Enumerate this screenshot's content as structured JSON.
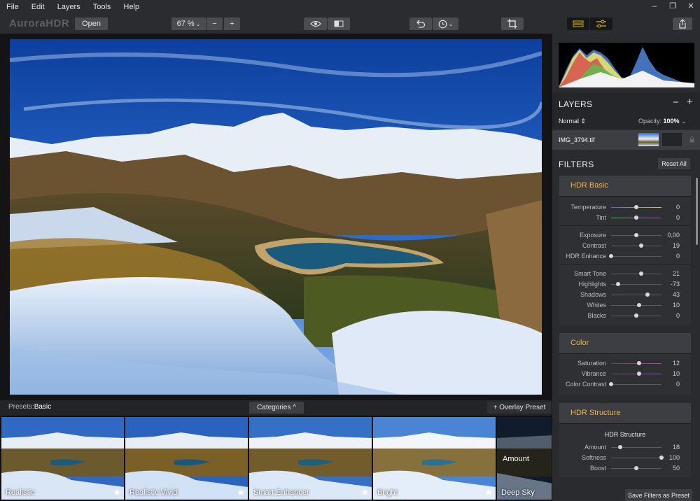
{
  "menu": [
    "File",
    "Edit",
    "Layers",
    "Tools",
    "Help"
  ],
  "window_controls": [
    "–",
    "❐",
    "✕"
  ],
  "toolbar": {
    "logo": "AuroraHDR",
    "open_label": "Open",
    "zoom": "67 %",
    "zoom_out": "−",
    "zoom_in": "+"
  },
  "presets_bar": {
    "label": "Presets:",
    "current": "Basic",
    "categories_label": "Categories ^",
    "overlay_label": "+ Overlay Preset"
  },
  "presets": [
    {
      "name": "Realistic"
    },
    {
      "name": "Realistic Vivid"
    },
    {
      "name": "Smart Enhancer"
    },
    {
      "name": "Bright"
    },
    {
      "name": "Deep Sky"
    }
  ],
  "amount_label": "Amount",
  "layers": {
    "title": "LAYERS",
    "minus": "−",
    "plus": "+",
    "blend_mode": "Normal",
    "opacity_label": "Opacity:",
    "opacity_value": "100%",
    "layer_name": "IMG_3794.tif"
  },
  "filters": {
    "title": "FILTERS",
    "reset_label": "Reset All",
    "hdr_basic": {
      "title": "HDR Basic",
      "groups": [
        [
          {
            "label": "Temperature",
            "value": "0",
            "pos": 0.5,
            "track": "temp"
          },
          {
            "label": "Tint",
            "value": "0",
            "pos": 0.5,
            "track": "tint"
          }
        ],
        [
          {
            "label": "Exposure",
            "value": "0,00",
            "pos": 0.5
          },
          {
            "label": "Contrast",
            "value": "19",
            "pos": 0.6
          },
          {
            "label": "HDR Enhance",
            "value": "0",
            "pos": 0.0
          }
        ],
        [
          {
            "label": "Smart Tone",
            "value": "21",
            "pos": 0.6
          },
          {
            "label": "Highlights",
            "value": "-73",
            "pos": 0.14
          },
          {
            "label": "Shadows",
            "value": "43",
            "pos": 0.72
          },
          {
            "label": "Whites",
            "value": "10",
            "pos": 0.55
          },
          {
            "label": "Blacks",
            "value": "0",
            "pos": 0.5
          }
        ]
      ]
    },
    "color": {
      "title": "Color",
      "sliders": [
        {
          "label": "Saturation",
          "value": "12",
          "pos": 0.56,
          "track": "sat"
        },
        {
          "label": "Vibrance",
          "value": "10",
          "pos": 0.55,
          "track": "vib"
        },
        {
          "label": "Color Contrast",
          "value": "0",
          "pos": 0.0
        }
      ]
    },
    "hdr_structure": {
      "title": "HDR Structure",
      "subtitle": "HDR Structure",
      "sliders": [
        {
          "label": "Amount",
          "value": "18",
          "pos": 0.18
        },
        {
          "label": "Softness",
          "value": "100",
          "pos": 1.0
        },
        {
          "label": "Boost",
          "value": "50",
          "pos": 0.5
        }
      ]
    },
    "save_label": "Save Filters as Preset"
  },
  "colors": {
    "accent": "#f0b43c",
    "panel": "#2a2b2f",
    "active_icon": "#e0b400"
  }
}
